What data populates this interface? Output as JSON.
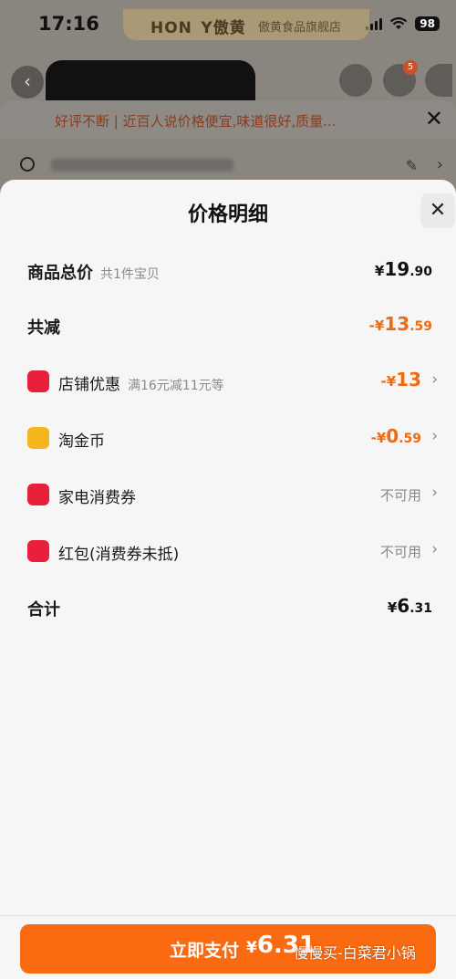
{
  "status_bar": {
    "time": "17:16",
    "battery": "98"
  },
  "background_page": {
    "brand_logo": "HON Y傲黄",
    "store_name": "傲黄食品旗舰店",
    "cart_badge": "5",
    "review_text": "好评不断 | 近百人说价格便宜,味道很好,质量..."
  },
  "sheet": {
    "title": "价格明细",
    "total": {
      "label": "商品总价",
      "sub": "共1件宝贝",
      "currency": "¥",
      "int": "19",
      "dec": ".90"
    },
    "reduction": {
      "label": "共减",
      "prefix": "-¥",
      "int": "13",
      "dec": ".59"
    },
    "items": [
      {
        "name": "店铺优惠",
        "sub": "满16元减11元等",
        "value_prefix": "-¥",
        "value_int": "13",
        "value_dec": ""
      },
      {
        "name": "淘金币",
        "sub": "",
        "value_prefix": "-¥",
        "value_int": "0",
        "value_dec": ".59"
      },
      {
        "name": "家电消费券",
        "status": "不可用"
      },
      {
        "name": "红包(消费券未抵)",
        "status": "不可用"
      }
    ],
    "sum": {
      "label": "合计",
      "currency": "¥",
      "int": "6",
      "dec": ".31"
    }
  },
  "footer": {
    "pay_label": "立即支付",
    "pay_currency": "¥",
    "pay_amount": "6.31",
    "watermark": "慢慢买-白菜君小锅"
  },
  "colors": {
    "accent": "#fa6a10",
    "negative": "#f06a12",
    "icon_red": "#e9203c",
    "icon_gold": "#f5b51c"
  }
}
